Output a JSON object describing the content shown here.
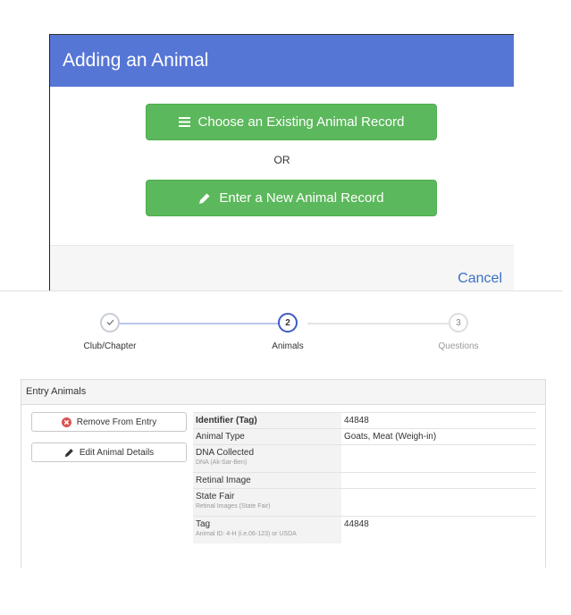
{
  "modal": {
    "title": "Adding an Animal",
    "choose_existing_label": "Choose an Existing Animal Record",
    "or_text": "OR",
    "enter_new_label": "Enter a New Animal Record",
    "cancel_label": "Cancel"
  },
  "stepper": {
    "steps": [
      {
        "label": "Club/Chapter",
        "number": "",
        "state": "complete"
      },
      {
        "label": "Animals",
        "number": "2",
        "state": "active"
      },
      {
        "label": "Questions",
        "number": "3",
        "state": "pending"
      }
    ]
  },
  "panel": {
    "title": "Entry Animals",
    "remove_label": "Remove From Entry",
    "edit_label": "Edit Animal Details",
    "rows": [
      {
        "label": "Identifier (Tag)",
        "sub": "",
        "value": "44848"
      },
      {
        "label": "Animal Type",
        "sub": "",
        "value": "Goats, Meat (Weigh-in)"
      },
      {
        "label": "DNA Collected",
        "sub": "DNA (Ak-Sar-Ben)",
        "value": ""
      },
      {
        "label": "Retinal Image",
        "sub": "",
        "value": ""
      },
      {
        "label": "State Fair",
        "sub": "Retinal Images (State Fair)",
        "value": ""
      },
      {
        "label": "Tag",
        "sub": "Animal ID: 4-H (i.e.06-123) or USDA",
        "value": "44848"
      }
    ]
  },
  "colors": {
    "header_blue": "#5676d6",
    "button_green": "#5cb85c",
    "link_blue": "#3b71c5",
    "step_active": "#3d5cc4",
    "remove_red": "#d9534f"
  },
  "icons": {
    "choose_existing": "list-icon",
    "enter_new": "pencil-icon",
    "remove": "remove-circle-icon",
    "edit": "pencil-icon",
    "step_complete": "check-icon"
  }
}
